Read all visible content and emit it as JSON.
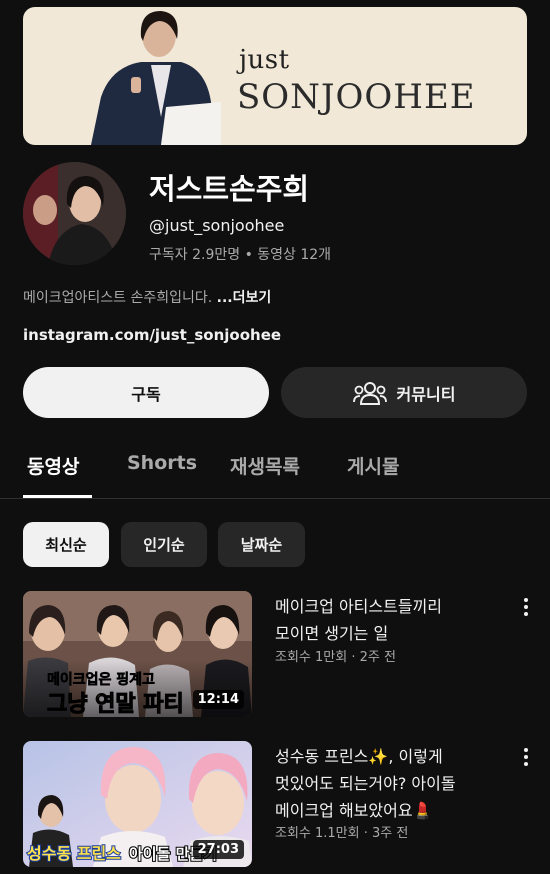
{
  "banner": {
    "brand_small": "just",
    "brand_big": "SONJOOHEE"
  },
  "channel": {
    "title": "저스트손주희",
    "handle": "@just_sonjoohee",
    "stats": "구독자 2.9만명 • 동영상 12개",
    "description": "메이크업아티스트 손주희입니다. ",
    "more_label": "...더보기",
    "link": "instagram.com/just_sonjoohee"
  },
  "actions": {
    "subscribe_label": "구독",
    "community_label": "커뮤니티"
  },
  "tabs": [
    {
      "label": "동영상",
      "active": true
    },
    {
      "label": "Shorts",
      "active": false
    },
    {
      "label": "재생목록",
      "active": false
    },
    {
      "label": "게시물",
      "active": false
    }
  ],
  "chips": [
    {
      "label": "최신순",
      "active": true
    },
    {
      "label": "인기순",
      "active": false
    },
    {
      "label": "날짜순",
      "active": false
    }
  ],
  "videos": [
    {
      "title_line1": "메이크업 아티스트들끼리",
      "title_line2": "모이면 생기는 일",
      "meta": "조회수 1만회 · 2주 전",
      "duration": "12:14",
      "thumb_caption_top": "메이크업은 핑계고",
      "thumb_caption_bottom": "그냥 연말 파티"
    },
    {
      "title_line1": "성수동 프린스✨, 이렇게",
      "title_line2": "멋있어도 되는거야? 아이돌",
      "title_line3": "메이크업 해보았어요💄",
      "meta": "조회수 1.1만회 · 3주 전",
      "duration": "27:03",
      "thumb_caption_a": "성수동 프린스",
      "thumb_caption_b": "아이돌 만들기"
    }
  ],
  "colors": {
    "background": "#0f0f0f",
    "chip_bg": "#272727",
    "active": "#f1f1f1",
    "banner_bg": "#f1e8d7"
  }
}
